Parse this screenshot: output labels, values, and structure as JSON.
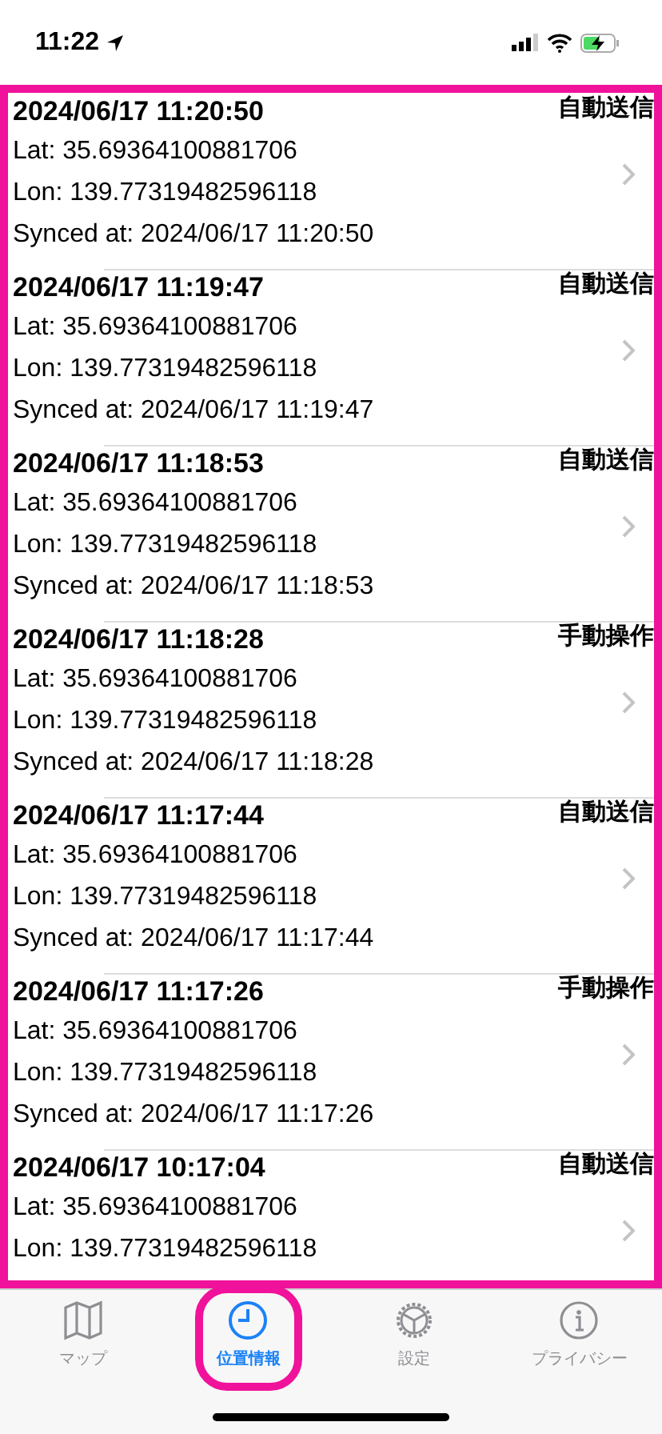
{
  "status_bar": {
    "time": "11:22"
  },
  "records": [
    {
      "timestamp": "2024/06/17 11:20:50",
      "mode": "自動送信",
      "lat": "Lat: 35.69364100881706",
      "lon": "Lon: 139.77319482596118",
      "synced": "Synced at: 2024/06/17 11:20:50"
    },
    {
      "timestamp": "2024/06/17 11:19:47",
      "mode": "自動送信",
      "lat": "Lat: 35.69364100881706",
      "lon": "Lon: 139.77319482596118",
      "synced": "Synced at: 2024/06/17 11:19:47"
    },
    {
      "timestamp": "2024/06/17 11:18:53",
      "mode": "自動送信",
      "lat": "Lat: 35.69364100881706",
      "lon": "Lon: 139.77319482596118",
      "synced": "Synced at: 2024/06/17 11:18:53"
    },
    {
      "timestamp": "2024/06/17 11:18:28",
      "mode": "手動操作",
      "lat": "Lat: 35.69364100881706",
      "lon": "Lon: 139.77319482596118",
      "synced": "Synced at: 2024/06/17 11:18:28"
    },
    {
      "timestamp": "2024/06/17 11:17:44",
      "mode": "自動送信",
      "lat": "Lat: 35.69364100881706",
      "lon": "Lon: 139.77319482596118",
      "synced": "Synced at: 2024/06/17 11:17:44"
    },
    {
      "timestamp": "2024/06/17 11:17:26",
      "mode": "手動操作",
      "lat": "Lat: 35.69364100881706",
      "lon": "Lon: 139.77319482596118",
      "synced": "Synced at: 2024/06/17 11:17:26"
    },
    {
      "timestamp": "2024/06/17 10:17:04",
      "mode": "自動送信",
      "lat": "Lat: 35.69364100881706",
      "lon": "Lon: 139.77319482596118"
    }
  ],
  "tabs": [
    {
      "kind": "map",
      "label": "マップ",
      "selected": false
    },
    {
      "kind": "clock",
      "label": "位置情報",
      "selected": true
    },
    {
      "kind": "gear",
      "label": "設定",
      "selected": false
    },
    {
      "kind": "info",
      "label": "プライバシー",
      "selected": false
    }
  ]
}
